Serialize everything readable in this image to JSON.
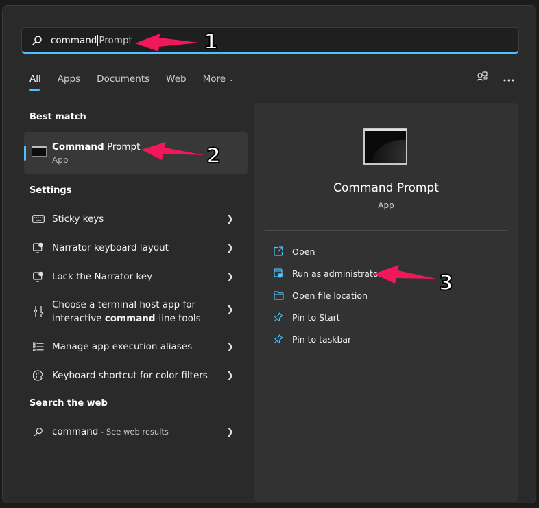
{
  "search": {
    "typed": "command",
    "suggestion": "Prompt"
  },
  "tabs": [
    {
      "label": "All",
      "active": true
    },
    {
      "label": "Apps"
    },
    {
      "label": "Documents"
    },
    {
      "label": "Web"
    },
    {
      "label": "More"
    }
  ],
  "top_icons": [
    "account-switch-icon",
    "more-options-icon"
  ],
  "best_match": {
    "header": "Best match",
    "title_bold": "Command",
    "title_rest": " Prompt",
    "subtitle": "App",
    "icon": "terminal-icon"
  },
  "settings": {
    "header": "Settings",
    "items": [
      {
        "label": "Sticky keys",
        "icon": "keyboard-icon"
      },
      {
        "label": "Narrator keyboard layout",
        "icon": "narrator-icon"
      },
      {
        "label": "Lock the Narrator key",
        "icon": "narrator-icon"
      },
      {
        "line1": "Choose a terminal host app for",
        "line2_pre": "interactive ",
        "line2_bold": "command",
        "line2_post": "-line tools",
        "icon": "developer-tools-icon"
      },
      {
        "label": "Manage app execution aliases",
        "icon": "list-icon"
      },
      {
        "label": "Keyboard shortcut for color filters",
        "icon": "color-filter-icon"
      }
    ]
  },
  "web": {
    "header": "Search the web",
    "query": "command",
    "suffix": " - See web results",
    "icon": "search-icon"
  },
  "detail": {
    "app_name": "Command Prompt",
    "app_type": "App",
    "actions": [
      {
        "label": "Open",
        "icon": "open-icon"
      },
      {
        "label": "Run as administrator",
        "icon": "shield-icon"
      },
      {
        "label": "Open file location",
        "icon": "folder-icon"
      },
      {
        "label": "Pin to Start",
        "icon": "pin-icon"
      },
      {
        "label": "Pin to taskbar",
        "icon": "pin-icon"
      }
    ]
  },
  "annotations": {
    "step1": "1",
    "step2": "2",
    "step3": "3",
    "arrow_color": "#f0185a"
  },
  "colors": {
    "accent": "#4cc2ff",
    "panel": "#2a2a2a",
    "highlight": "#383838"
  }
}
